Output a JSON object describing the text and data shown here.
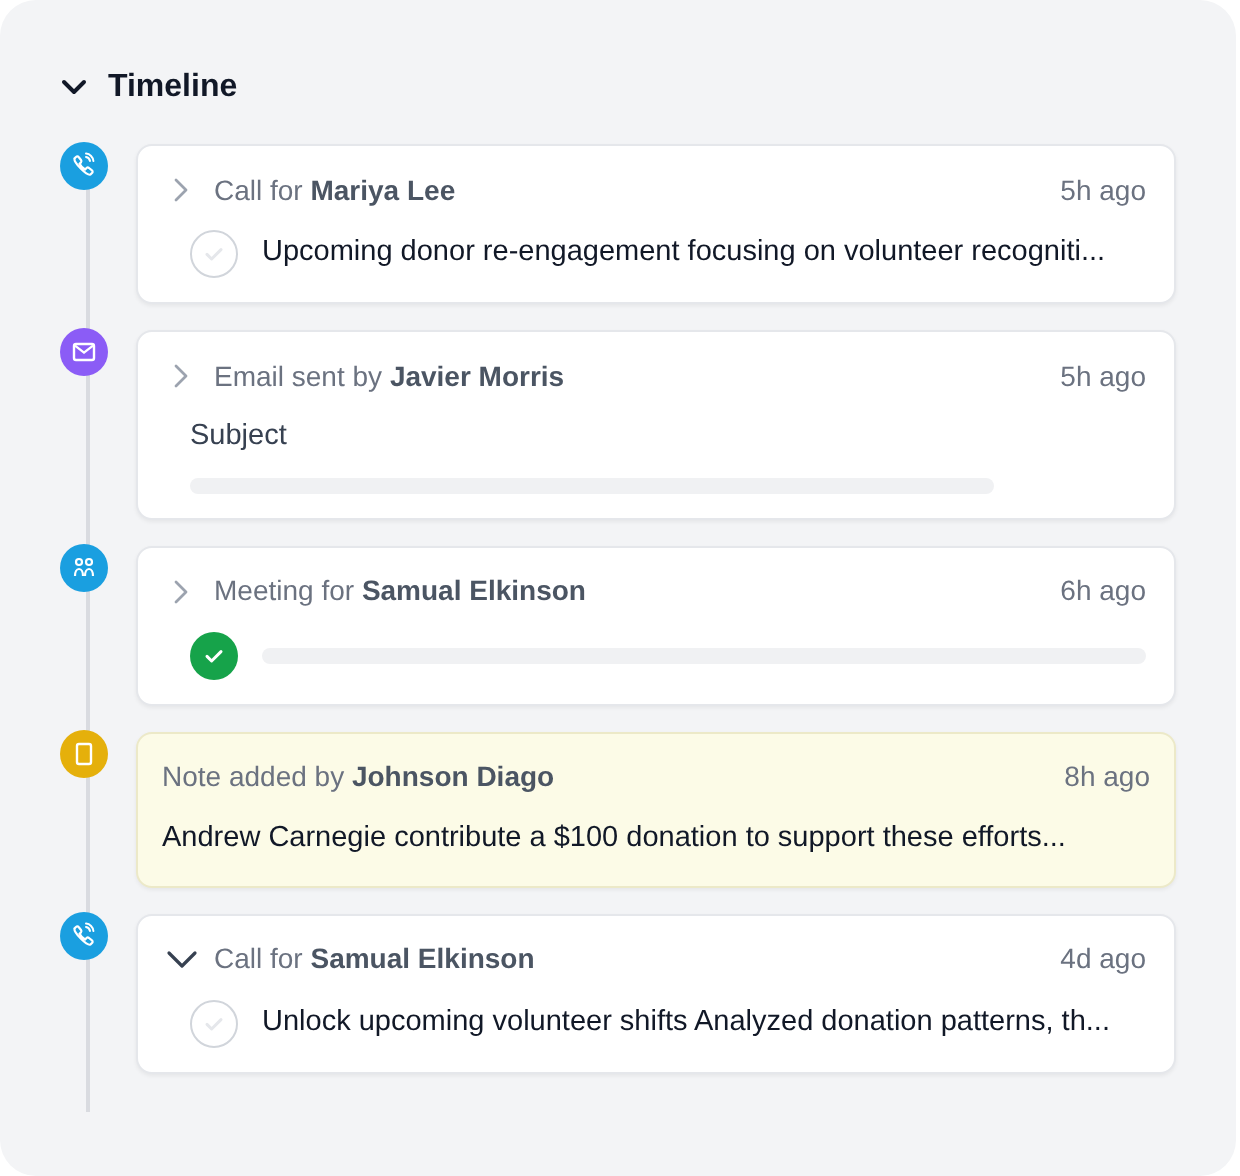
{
  "section": {
    "title": "Timeline",
    "expanded": true
  },
  "entries": [
    {
      "kind": "call",
      "color": "#1a9fe0",
      "expanded": false,
      "prefix": "Call for",
      "name": "Mariya Lee",
      "time": "5h ago",
      "task": {
        "text": "Upcoming donor re-engagement focusing on volunteer recogniti...",
        "checked": false
      }
    },
    {
      "kind": "email",
      "color": "#8b5cf6",
      "expanded": false,
      "prefix": "Email sent by",
      "name": "Javier Morris",
      "time": "5h ago",
      "subject": "Subject"
    },
    {
      "kind": "meeting",
      "color": "#1a9fe0",
      "expanded": false,
      "prefix": "Meeting for",
      "name": "Samual Elkinson",
      "time": "6h ago",
      "task": {
        "checked": true
      }
    },
    {
      "kind": "note",
      "color": "#e5b00b",
      "prefix": "Note added by",
      "name": "Johnson Diago",
      "time": "8h ago",
      "note": "Andrew Carnegie contribute a $100 donation to support these efforts..."
    },
    {
      "kind": "call",
      "color": "#1a9fe0",
      "expanded": true,
      "prefix": "Call for",
      "name": "Samual Elkinson",
      "time": "4d ago",
      "task": {
        "text": "Unlock upcoming volunteer shifts Analyzed donation patterns, th...",
        "checked": false
      }
    }
  ]
}
